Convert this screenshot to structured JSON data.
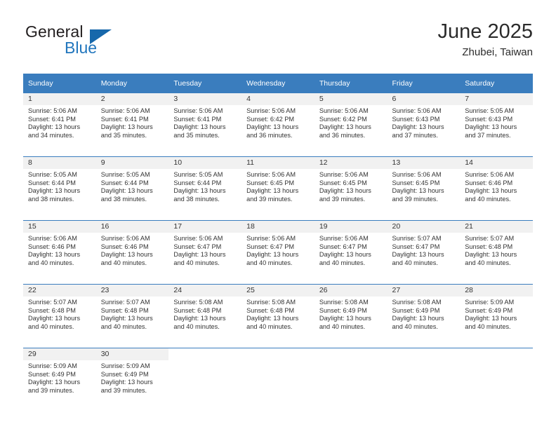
{
  "brand": {
    "name_top": "General",
    "name_bottom": "Blue",
    "triangle_color": "#1768ab",
    "blue_color": "#2176bd"
  },
  "header": {
    "title": "June 2025",
    "subtitle": "Zhubei, Taiwan"
  },
  "theme": {
    "header_bg": "#3a7dbe",
    "header_text": "#ffffff",
    "daynum_band_bg": "#f1f1f1",
    "cell_bg": "#ffffff",
    "row_border": "#3a7dbe"
  },
  "weekday_headers": [
    "Sunday",
    "Monday",
    "Tuesday",
    "Wednesday",
    "Thursday",
    "Friday",
    "Saturday"
  ],
  "weeks": [
    [
      {
        "day": "1",
        "sunrise": "Sunrise: 5:06 AM",
        "sunset": "Sunset: 6:41 PM",
        "daylight1": "Daylight: 13 hours",
        "daylight2": "and 34 minutes."
      },
      {
        "day": "2",
        "sunrise": "Sunrise: 5:06 AM",
        "sunset": "Sunset: 6:41 PM",
        "daylight1": "Daylight: 13 hours",
        "daylight2": "and 35 minutes."
      },
      {
        "day": "3",
        "sunrise": "Sunrise: 5:06 AM",
        "sunset": "Sunset: 6:41 PM",
        "daylight1": "Daylight: 13 hours",
        "daylight2": "and 35 minutes."
      },
      {
        "day": "4",
        "sunrise": "Sunrise: 5:06 AM",
        "sunset": "Sunset: 6:42 PM",
        "daylight1": "Daylight: 13 hours",
        "daylight2": "and 36 minutes."
      },
      {
        "day": "5",
        "sunrise": "Sunrise: 5:06 AM",
        "sunset": "Sunset: 6:42 PM",
        "daylight1": "Daylight: 13 hours",
        "daylight2": "and 36 minutes."
      },
      {
        "day": "6",
        "sunrise": "Sunrise: 5:06 AM",
        "sunset": "Sunset: 6:43 PM",
        "daylight1": "Daylight: 13 hours",
        "daylight2": "and 37 minutes."
      },
      {
        "day": "7",
        "sunrise": "Sunrise: 5:05 AM",
        "sunset": "Sunset: 6:43 PM",
        "daylight1": "Daylight: 13 hours",
        "daylight2": "and 37 minutes."
      }
    ],
    [
      {
        "day": "8",
        "sunrise": "Sunrise: 5:05 AM",
        "sunset": "Sunset: 6:44 PM",
        "daylight1": "Daylight: 13 hours",
        "daylight2": "and 38 minutes."
      },
      {
        "day": "9",
        "sunrise": "Sunrise: 5:05 AM",
        "sunset": "Sunset: 6:44 PM",
        "daylight1": "Daylight: 13 hours",
        "daylight2": "and 38 minutes."
      },
      {
        "day": "10",
        "sunrise": "Sunrise: 5:05 AM",
        "sunset": "Sunset: 6:44 PM",
        "daylight1": "Daylight: 13 hours",
        "daylight2": "and 38 minutes."
      },
      {
        "day": "11",
        "sunrise": "Sunrise: 5:06 AM",
        "sunset": "Sunset: 6:45 PM",
        "daylight1": "Daylight: 13 hours",
        "daylight2": "and 39 minutes."
      },
      {
        "day": "12",
        "sunrise": "Sunrise: 5:06 AM",
        "sunset": "Sunset: 6:45 PM",
        "daylight1": "Daylight: 13 hours",
        "daylight2": "and 39 minutes."
      },
      {
        "day": "13",
        "sunrise": "Sunrise: 5:06 AM",
        "sunset": "Sunset: 6:45 PM",
        "daylight1": "Daylight: 13 hours",
        "daylight2": "and 39 minutes."
      },
      {
        "day": "14",
        "sunrise": "Sunrise: 5:06 AM",
        "sunset": "Sunset: 6:46 PM",
        "daylight1": "Daylight: 13 hours",
        "daylight2": "and 40 minutes."
      }
    ],
    [
      {
        "day": "15",
        "sunrise": "Sunrise: 5:06 AM",
        "sunset": "Sunset: 6:46 PM",
        "daylight1": "Daylight: 13 hours",
        "daylight2": "and 40 minutes."
      },
      {
        "day": "16",
        "sunrise": "Sunrise: 5:06 AM",
        "sunset": "Sunset: 6:46 PM",
        "daylight1": "Daylight: 13 hours",
        "daylight2": "and 40 minutes."
      },
      {
        "day": "17",
        "sunrise": "Sunrise: 5:06 AM",
        "sunset": "Sunset: 6:47 PM",
        "daylight1": "Daylight: 13 hours",
        "daylight2": "and 40 minutes."
      },
      {
        "day": "18",
        "sunrise": "Sunrise: 5:06 AM",
        "sunset": "Sunset: 6:47 PM",
        "daylight1": "Daylight: 13 hours",
        "daylight2": "and 40 minutes."
      },
      {
        "day": "19",
        "sunrise": "Sunrise: 5:06 AM",
        "sunset": "Sunset: 6:47 PM",
        "daylight1": "Daylight: 13 hours",
        "daylight2": "and 40 minutes."
      },
      {
        "day": "20",
        "sunrise": "Sunrise: 5:07 AM",
        "sunset": "Sunset: 6:47 PM",
        "daylight1": "Daylight: 13 hours",
        "daylight2": "and 40 minutes."
      },
      {
        "day": "21",
        "sunrise": "Sunrise: 5:07 AM",
        "sunset": "Sunset: 6:48 PM",
        "daylight1": "Daylight: 13 hours",
        "daylight2": "and 40 minutes."
      }
    ],
    [
      {
        "day": "22",
        "sunrise": "Sunrise: 5:07 AM",
        "sunset": "Sunset: 6:48 PM",
        "daylight1": "Daylight: 13 hours",
        "daylight2": "and 40 minutes."
      },
      {
        "day": "23",
        "sunrise": "Sunrise: 5:07 AM",
        "sunset": "Sunset: 6:48 PM",
        "daylight1": "Daylight: 13 hours",
        "daylight2": "and 40 minutes."
      },
      {
        "day": "24",
        "sunrise": "Sunrise: 5:08 AM",
        "sunset": "Sunset: 6:48 PM",
        "daylight1": "Daylight: 13 hours",
        "daylight2": "and 40 minutes."
      },
      {
        "day": "25",
        "sunrise": "Sunrise: 5:08 AM",
        "sunset": "Sunset: 6:48 PM",
        "daylight1": "Daylight: 13 hours",
        "daylight2": "and 40 minutes."
      },
      {
        "day": "26",
        "sunrise": "Sunrise: 5:08 AM",
        "sunset": "Sunset: 6:49 PM",
        "daylight1": "Daylight: 13 hours",
        "daylight2": "and 40 minutes."
      },
      {
        "day": "27",
        "sunrise": "Sunrise: 5:08 AM",
        "sunset": "Sunset: 6:49 PM",
        "daylight1": "Daylight: 13 hours",
        "daylight2": "and 40 minutes."
      },
      {
        "day": "28",
        "sunrise": "Sunrise: 5:09 AM",
        "sunset": "Sunset: 6:49 PM",
        "daylight1": "Daylight: 13 hours",
        "daylight2": "and 40 minutes."
      }
    ],
    [
      {
        "day": "29",
        "sunrise": "Sunrise: 5:09 AM",
        "sunset": "Sunset: 6:49 PM",
        "daylight1": "Daylight: 13 hours",
        "daylight2": "and 39 minutes."
      },
      {
        "day": "30",
        "sunrise": "Sunrise: 5:09 AM",
        "sunset": "Sunset: 6:49 PM",
        "daylight1": "Daylight: 13 hours",
        "daylight2": "and 39 minutes."
      },
      {
        "day": "",
        "sunrise": "",
        "sunset": "",
        "daylight1": "",
        "daylight2": ""
      },
      {
        "day": "",
        "sunrise": "",
        "sunset": "",
        "daylight1": "",
        "daylight2": ""
      },
      {
        "day": "",
        "sunrise": "",
        "sunset": "",
        "daylight1": "",
        "daylight2": ""
      },
      {
        "day": "",
        "sunrise": "",
        "sunset": "",
        "daylight1": "",
        "daylight2": ""
      },
      {
        "day": "",
        "sunrise": "",
        "sunset": "",
        "daylight1": "",
        "daylight2": ""
      }
    ]
  ]
}
